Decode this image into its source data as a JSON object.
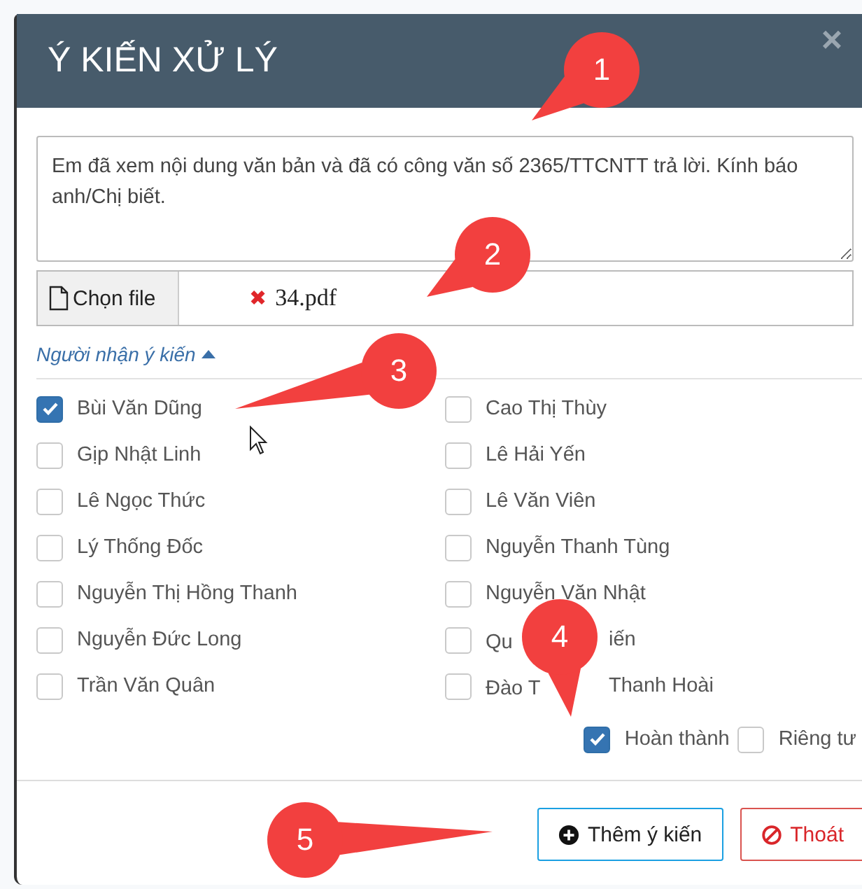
{
  "dialog": {
    "title": "Ý KIẾN XỬ LÝ",
    "close": "×"
  },
  "comment": {
    "value": "Em đã xem nội dung văn bản và đã có công văn số 2365/TTCNTT trả lời. Kính báo anh/Chị biết."
  },
  "file": {
    "button": "Chọn file",
    "remove": "✖",
    "name": "34.pdf"
  },
  "recipients": {
    "label": "Người nhận ý kiến",
    "expanded": true,
    "people": [
      {
        "parts": [
          "Bùi Văn Dũng"
        ],
        "checked": true
      },
      {
        "parts": [
          "Cao Thị Thùy"
        ],
        "checked": false
      },
      {
        "parts": [
          "Gịp Nhật Linh"
        ],
        "checked": false
      },
      {
        "parts": [
          "Lê Hải Yến"
        ],
        "checked": false
      },
      {
        "parts": [
          "Lê Ngọc Thức"
        ],
        "checked": false
      },
      {
        "parts": [
          "Lê Văn Viên"
        ],
        "checked": false
      },
      {
        "parts": [
          "Lý Thống Đốc"
        ],
        "checked": false
      },
      {
        "parts": [
          "Nguyễn Thanh Tùng"
        ],
        "checked": false
      },
      {
        "parts": [
          "Nguyễn Thị Hồng Thanh"
        ],
        "checked": false
      },
      {
        "parts": [
          "Nguyễn Văn Nhật"
        ],
        "checked": false
      },
      {
        "parts": [
          "Nguyễn Đức Long"
        ],
        "checked": false
      },
      {
        "parts": [
          "Qu",
          "iến"
        ],
        "checked": false
      },
      {
        "parts": [
          "Trần Văn Quân"
        ],
        "checked": false
      },
      {
        "parts": [
          "Đào T",
          "Thanh Hoài"
        ],
        "checked": false
      }
    ]
  },
  "options": [
    {
      "label": "Hoàn thành",
      "checked": true
    },
    {
      "label": "Riêng tư",
      "checked": false
    }
  ],
  "buttons": [
    {
      "label": "Thêm ý kiến",
      "kind": "primary"
    },
    {
      "label": "Thoát",
      "kind": "danger"
    }
  ],
  "callouts": [
    {
      "number": "1"
    },
    {
      "number": "2"
    },
    {
      "number": "3"
    },
    {
      "number": "4"
    },
    {
      "number": "5"
    }
  ]
}
